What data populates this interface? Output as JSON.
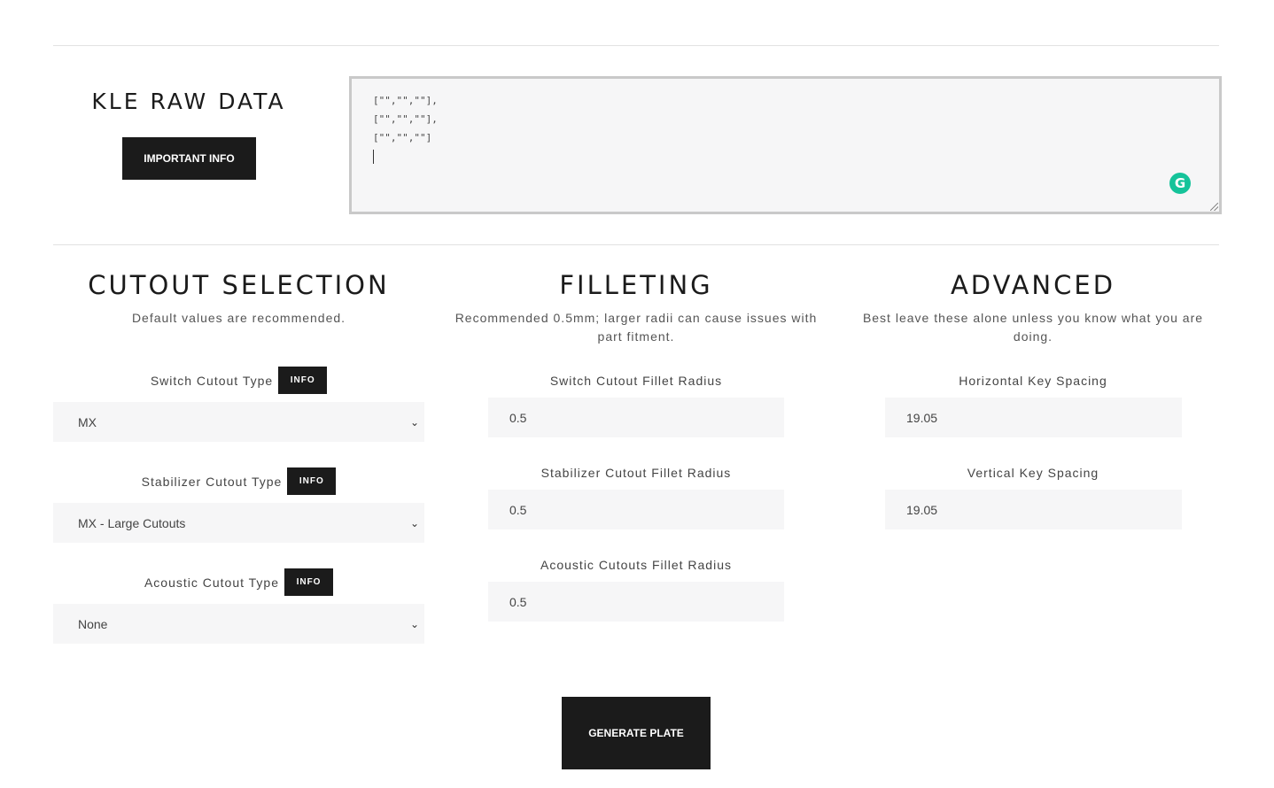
{
  "kle": {
    "title": "KLE RAW DATA",
    "important_label": "IMPORTANT INFO",
    "textarea_lines": [
      "[\"\",\"\",\"\"],",
      "[\"\",\"\",\"\"],",
      "[\"\",\"\",\"\"]"
    ]
  },
  "cutout": {
    "title": "CUTOUT SELECTION",
    "subtitle": "Default values are recommended.",
    "switch_label": "Switch Cutout Type",
    "switch_value": "MX",
    "stab_label": "Stabilizer Cutout Type",
    "stab_value": "MX - Large Cutouts",
    "acoustic_label": "Acoustic Cutout Type",
    "acoustic_value": "None",
    "info_label": "INFO"
  },
  "filleting": {
    "title": "FILLETING",
    "subtitle": "Recommended 0.5mm; larger radii can cause issues with part fitment.",
    "switch_label": "Switch Cutout Fillet Radius",
    "switch_value": "0.5",
    "stab_label": "Stabilizer Cutout Fillet Radius",
    "stab_value": "0.5",
    "acoustic_label": "Acoustic Cutouts Fillet Radius",
    "acoustic_value": "0.5"
  },
  "advanced": {
    "title": "ADVANCED",
    "subtitle": "Best leave these alone unless you know what you are doing.",
    "horizontal_label": "Horizontal Key Spacing",
    "horizontal_value": "19.05",
    "vertical_label": "Vertical Key Spacing",
    "vertical_value": "19.05"
  },
  "generate_label": "GENERATE PLATE",
  "icons": {
    "grammarly": "grammarly-icon",
    "select_arrow": "chevron-down-icon"
  }
}
